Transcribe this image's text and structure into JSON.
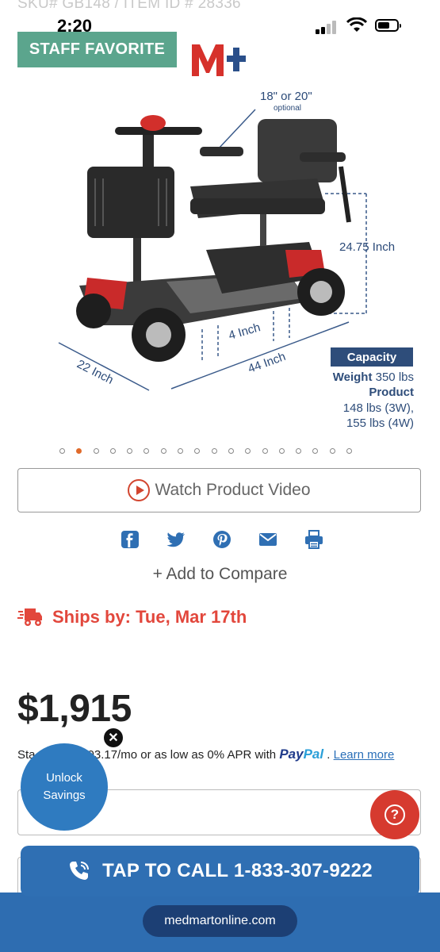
{
  "status_bar": {
    "time": "2:20"
  },
  "header": {
    "sku": "SKU# GB148 / ITEM ID # 28336",
    "badge": "STAFF FAVORITE"
  },
  "product_image": {
    "dim_seat": "18\" or 20\"",
    "dim_seat_note": "optional",
    "dim_height": "24.75 Inch",
    "dim_width": "22 Inch",
    "dim_length": "44 Inch",
    "dim_clearance": "4 Inch",
    "capacity_title": "Capacity",
    "weight_label": "Weight",
    "weight_value": "350 lbs",
    "product_label": "Product",
    "product_w1": "148 lbs (3W),",
    "product_w2": "155 lbs (4W)"
  },
  "carousel": {
    "total": 18,
    "active_index": 1
  },
  "video_button": {
    "label": "Watch Product Video"
  },
  "share": {
    "icons": [
      "facebook-icon",
      "twitter-icon",
      "pinterest-icon",
      "email-icon",
      "print-icon"
    ]
  },
  "compare": {
    "label": "+ Add to Compare"
  },
  "shipping": {
    "label": "Ships by: Tue, Mar 17th"
  },
  "pricing": {
    "price": "$1,915",
    "finance_start": "Sta",
    "finance_mid": "03.17/mo or as low as 0% APR with",
    "paypal_a": "Pay",
    "paypal_b": "Pal",
    "finance_dot": ".",
    "learn_more": "Learn more"
  },
  "promo": {
    "unlock_line1": "Unlock",
    "unlock_line2": "Savings",
    "close": "✕"
  },
  "select": {
    "value": "/"
  },
  "help": {
    "label": "?"
  },
  "call": {
    "label": "TAP TO CALL 1-833-307-9222"
  },
  "browser": {
    "url": "medmartonline.com"
  },
  "colors": {
    "accent": "#2f6fb3",
    "ship_red": "#e2473c",
    "badge_green": "#5ba58d",
    "carousel_active": "#e06a2a"
  }
}
